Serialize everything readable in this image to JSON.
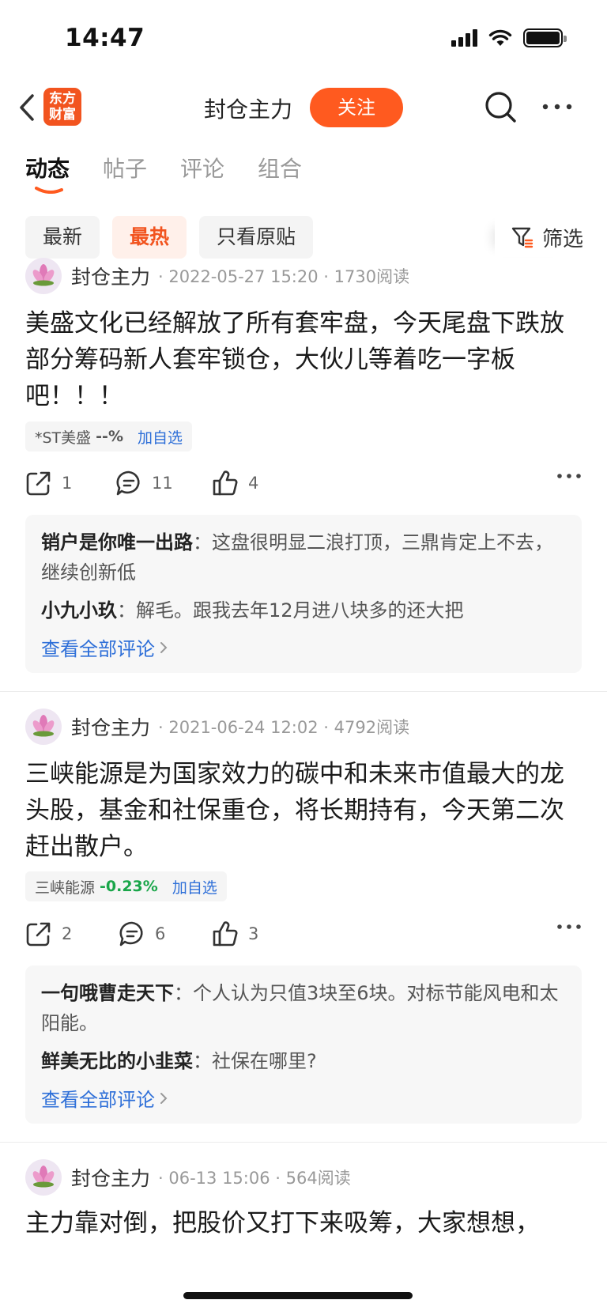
{
  "status_bar": {
    "time": "14:47"
  },
  "header": {
    "logo_text": "东方财富",
    "title": "封仓主力",
    "follow_label": "关注"
  },
  "tabs": [
    {
      "label": "动态",
      "active": true
    },
    {
      "label": "帖子",
      "active": false
    },
    {
      "label": "评论",
      "active": false
    },
    {
      "label": "组合",
      "active": false
    }
  ],
  "filters": {
    "chips": [
      {
        "label": "最新",
        "active": false
      },
      {
        "label": "最热",
        "active": true
      },
      {
        "label": "只看原贴",
        "active": false
      }
    ],
    "filter_label": "筛选"
  },
  "posts": [
    {
      "author": "封仓主力",
      "meta": "· 2022-05-27 15:20 · 1730阅读",
      "body": "美盛文化已经解放了所有套牢盘，今天尾盘下跌放部分筹码新人套牢锁仓，大伙儿等着吃一字板吧！！！",
      "stock": {
        "name": "*ST美盛",
        "change": "--%",
        "add_label": "加自选"
      },
      "shares": "1",
      "comments": "11",
      "likes": "4",
      "comment_list": [
        {
          "user": "销户是你唯一出路",
          "text": "这盘很明显二浪打顶，三鼎肯定上不去，继续创新低"
        },
        {
          "user": "小九小玖",
          "text": "解毛。跟我去年12月进八块多的还大把"
        }
      ],
      "view_all": "查看全部评论"
    },
    {
      "author": "封仓主力",
      "meta": "· 2021-06-24 12:02 · 4792阅读",
      "body": "三峡能源是为国家效力的碳中和未来市值最大的龙头股，基金和社保重仓，将长期持有，今天第二次赶出散户。",
      "stock": {
        "name": "三峡能源",
        "change": "-0.23%",
        "add_label": "加自选"
      },
      "shares": "2",
      "comments": "6",
      "likes": "3",
      "comment_list": [
        {
          "user": "一句哦曹走天下",
          "text": "个人认为只值3块至6块。对标节能风电和太阳能。"
        },
        {
          "user": "鲜美无比的小韭菜",
          "text": "社保在哪里?"
        }
      ],
      "view_all": "查看全部评论"
    },
    {
      "author": "封仓主力",
      "meta": "· 06-13 15:06 · 564阅读",
      "body": "主力靠对倒，把股价又打下来吸筹，大家想想，"
    }
  ],
  "colors": {
    "accent": "#ff5a1f",
    "link": "#2e6fd8",
    "down_green": "#1aa64a"
  }
}
